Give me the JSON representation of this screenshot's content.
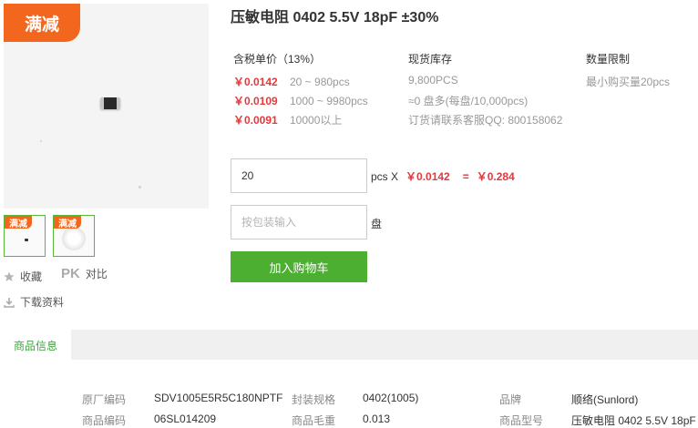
{
  "badges": {
    "main": "满减",
    "thumb": "满减"
  },
  "left_actions": {
    "favorite_label": "收藏",
    "compare_mark": "PK",
    "compare_label": "对比",
    "download_label": "下载资料"
  },
  "product": {
    "title": "压敏电阻 0402 5.5V 18pF ±30%"
  },
  "pricing": {
    "header": "含税单价（13%）",
    "tiers": [
      {
        "price": "￥0.0142",
        "range": "20 ~ 980pcs"
      },
      {
        "price": "￥0.0109",
        "range": "1000 ~ 9980pcs"
      },
      {
        "price": "￥0.0091",
        "range": "10000以上"
      }
    ]
  },
  "stock": {
    "header": "现货库存",
    "quantity": "9,800PCS",
    "reels": "≈0 盘多(每盘/10,000pcs)",
    "contact": "订货请联系客服QQ: 800158062"
  },
  "limit": {
    "header": "数量限制",
    "min_text": "最小购买量20pcs"
  },
  "order": {
    "qty_value": "20",
    "qty_unit": "pcs X",
    "unit_price": "￥0.0142",
    "equals": "=",
    "total": "￥0.284",
    "reel_placeholder": "按包装输入",
    "reel_unit": "盘",
    "add_to_cart": "加入购物车"
  },
  "tabs": [
    {
      "label": "商品信息",
      "active": true
    }
  ],
  "specs": {
    "left": [
      {
        "label": "原厂编码",
        "value": "SDV1005E5R5C180NPTF"
      },
      {
        "label": "商品编码",
        "value": "06SL014209"
      }
    ],
    "middle": [
      {
        "label": "封装规格",
        "value": "0402(1005)"
      },
      {
        "label": "商品毛重",
        "value": "0.013"
      }
    ],
    "right": [
      {
        "label": "品牌",
        "value": "顺络(Sunlord)"
      },
      {
        "label": "商品型号",
        "value": "压敏电阻 0402 5.5V 18pF"
      }
    ]
  },
  "colors": {
    "badge": "#f2661d",
    "price": "#e4393c",
    "accent_green": "#4caf32",
    "tab_active_text": "#3ba33b"
  }
}
